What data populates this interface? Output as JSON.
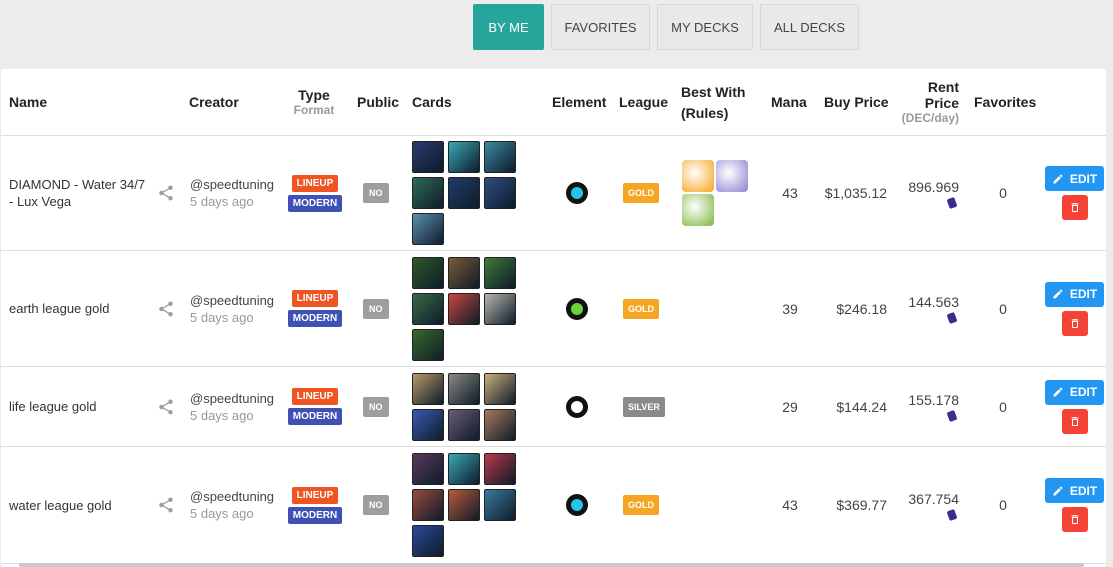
{
  "tabs": [
    {
      "label": "BY ME",
      "active": true
    },
    {
      "label": "FAVORITES",
      "active": false
    },
    {
      "label": "MY DECKS",
      "active": false
    },
    {
      "label": "ALL DECKS",
      "active": false
    }
  ],
  "columns": {
    "name": "Name",
    "creator": "Creator",
    "type": "Type",
    "type_sub": "Format",
    "public": "Public",
    "cards": "Cards",
    "element": "Element",
    "league": "League",
    "best_with_1": "Best With",
    "best_with_2": "(Rules)",
    "mana": "Mana",
    "buy_price": "Buy Price",
    "rent_1": "Rent",
    "rent_2": "Price",
    "rent_sub": "(DEC/day)",
    "favorites": "Favorites"
  },
  "actions": {
    "edit_label": "EDIT",
    "edit_icon": "pencil-icon",
    "delete_icon": "trash-icon",
    "share_icon": "share-icon"
  },
  "rows": [
    {
      "name": "DIAMOND - Water 34/7 - Lux Vega",
      "creator": "@speedtuning",
      "age": "5 days ago",
      "type": "LINEUP",
      "format": "MODERN",
      "public": "NO",
      "card_colors": [
        "#2b3a6e",
        "#3ba7b7",
        "#3a8aa0",
        "#2e6b5a",
        "#1f3d6b",
        "#2d4f80",
        "#5a8fb0"
      ],
      "element": "water",
      "element_color": "#23c4e6",
      "league": "GOLD",
      "rule_colors": [
        "#f6a21a",
        "#8a7fd1",
        "#7cb53d"
      ],
      "mana": "43",
      "buy_price": "$1,035.12",
      "rent_price": "896.969",
      "favorites": "0"
    },
    {
      "name": "earth league gold",
      "creator": "@speedtuning",
      "age": "5 days ago",
      "type": "LINEUP",
      "format": "MODERN",
      "public": "NO",
      "card_colors": [
        "#2d5a2a",
        "#7b5a36",
        "#3f7a3b",
        "#3a6a48",
        "#c8473f",
        "#b8b6b0",
        "#3a6a2a"
      ],
      "element": "earth",
      "element_color": "#6fd23a",
      "league": "GOLD",
      "rule_colors": [],
      "mana": "39",
      "buy_price": "$246.18",
      "rent_price": "144.563",
      "favorites": "0"
    },
    {
      "name": "life league gold",
      "creator": "@speedtuning",
      "age": "5 days ago",
      "type": "LINEUP",
      "format": "MODERN",
      "public": "NO",
      "card_colors": [
        "#b89a6a",
        "#8a8a80",
        "#c8b07a",
        "#3a5ab0",
        "#6a5a7a",
        "#a8785a"
      ],
      "element": "life",
      "element_color": "#ffffff",
      "league": "SILVER",
      "rule_colors": [],
      "mana": "29",
      "buy_price": "$144.24",
      "rent_price": "155.178",
      "favorites": "0"
    },
    {
      "name": "water league gold",
      "creator": "@speedtuning",
      "age": "5 days ago",
      "type": "LINEUP",
      "format": "MODERN",
      "public": "NO",
      "card_colors": [
        "#5a3a5a",
        "#3ba7b7",
        "#b83a4a",
        "#9a4a3a",
        "#b85a3a",
        "#3a7aa0",
        "#2a4a9a"
      ],
      "element": "water",
      "element_color": "#23c4e6",
      "league": "GOLD",
      "rule_colors": [],
      "mana": "43",
      "buy_price": "$369.77",
      "rent_price": "367.754",
      "favorites": "0"
    }
  ]
}
